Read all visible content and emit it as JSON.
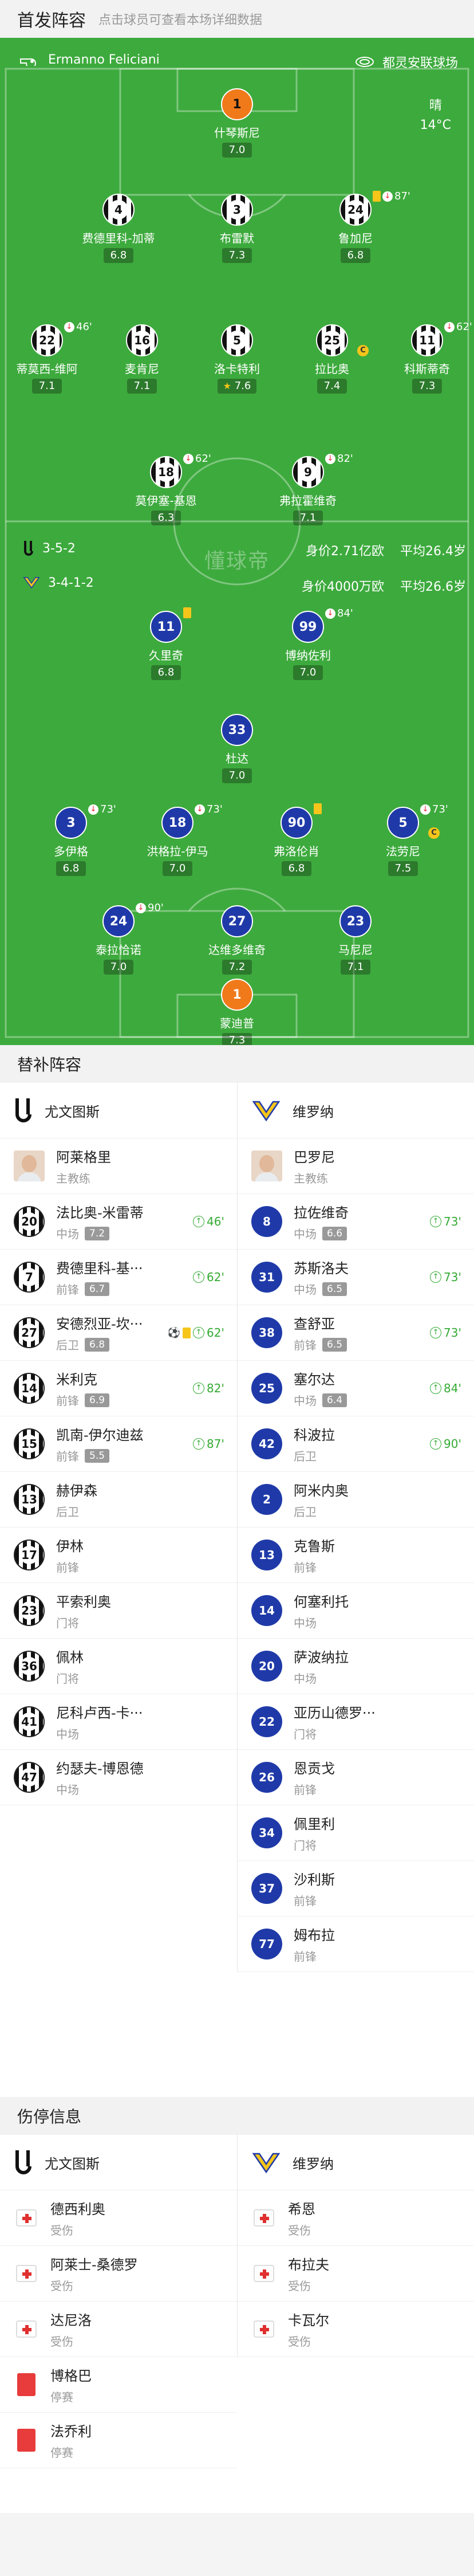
{
  "header": {
    "title": "首发阵容",
    "subtitle": "点击球员可查看本场详细数据"
  },
  "match": {
    "referee": "Ermanno Feliciani",
    "venue": "都灵安联球场",
    "weather": "晴",
    "temperature": "14°C"
  },
  "home": {
    "name": "尤文图斯",
    "formation": "3-5-2",
    "value": "身价2.71亿欧",
    "avg_age": "平均26.4岁",
    "players": [
      {
        "num": "1",
        "name": "什琴斯尼",
        "rating": "7.0"
      },
      {
        "num": "4",
        "name": "费德里科-加蒂",
        "rating": "6.8"
      },
      {
        "num": "3",
        "name": "布雷默",
        "rating": "7.3"
      },
      {
        "num": "24",
        "name": "鲁加尼",
        "rating": "6.8",
        "sub": "87'"
      },
      {
        "num": "22",
        "name": "蒂莫西-维阿",
        "rating": "7.1",
        "sub": "46'"
      },
      {
        "num": "16",
        "name": "麦肯尼",
        "rating": "7.1"
      },
      {
        "num": "5",
        "name": "洛卡特利",
        "rating": "7.6"
      },
      {
        "num": "25",
        "name": "拉比奥",
        "rating": "7.4"
      },
      {
        "num": "11",
        "name": "科斯蒂奇",
        "rating": "7.3",
        "sub": "62'"
      },
      {
        "num": "18",
        "name": "莫伊塞-基恩",
        "rating": "6.3",
        "sub": "62'"
      },
      {
        "num": "9",
        "name": "弗拉霍维奇",
        "rating": "7.1",
        "sub": "82'"
      }
    ]
  },
  "away": {
    "name": "维罗纳",
    "formation": "3-4-1-2",
    "value": "身价4000万欧",
    "avg_age": "平均26.6岁",
    "players": [
      {
        "num": "11",
        "name": "久里奇",
        "rating": "6.8"
      },
      {
        "num": "99",
        "name": "博纳佐利",
        "rating": "7.0",
        "sub": "84'"
      },
      {
        "num": "33",
        "name": "杜达",
        "rating": "7.0"
      },
      {
        "num": "3",
        "name": "多伊格",
        "rating": "6.8",
        "sub": "73'"
      },
      {
        "num": "18",
        "name": "洪格拉-伊马",
        "rating": "7.0",
        "sub": "73'"
      },
      {
        "num": "90",
        "name": "弗洛伦肖",
        "rating": "6.8"
      },
      {
        "num": "5",
        "name": "法劳尼",
        "rating": "7.5",
        "sub": "73'"
      },
      {
        "num": "24",
        "name": "泰拉恰诺",
        "rating": "7.0",
        "sub": "90'"
      },
      {
        "num": "27",
        "name": "达维多维奇",
        "rating": "7.2"
      },
      {
        "num": "23",
        "name": "马尼尼",
        "rating": "7.1"
      },
      {
        "num": "1",
        "name": "蒙迪普",
        "rating": "7.3"
      }
    ]
  },
  "watermark": "懂球帝",
  "subs_section": {
    "title": "替补阵容",
    "home_coach": {
      "name": "阿莱格里",
      "role": "主教练"
    },
    "away_coach": {
      "name": "巴罗尼",
      "role": "主教练"
    },
    "home": [
      {
        "num": "20",
        "name": "法比奥-米雷蒂",
        "pos": "中场",
        "rating": "7.2",
        "in": "46'"
      },
      {
        "num": "7",
        "name": "费德里科-基···",
        "pos": "前锋",
        "rating": "6.7",
        "in": "62'"
      },
      {
        "num": "27",
        "name": "安德烈亚-坎···",
        "pos": "后卫",
        "rating": "6.8",
        "in": "62'"
      },
      {
        "num": "14",
        "name": "米利克",
        "pos": "前锋",
        "rating": "6.9",
        "in": "82'"
      },
      {
        "num": "15",
        "name": "凯南-伊尔迪兹",
        "pos": "前锋",
        "rating": "5.5",
        "in": "87'"
      },
      {
        "num": "13",
        "name": "赫伊森",
        "pos": "后卫"
      },
      {
        "num": "17",
        "name": "伊林",
        "pos": "前锋"
      },
      {
        "num": "23",
        "name": "平索利奥",
        "pos": "门将"
      },
      {
        "num": "36",
        "name": "佩林",
        "pos": "门将"
      },
      {
        "num": "41",
        "name": "尼科卢西-卡···",
        "pos": "中场"
      },
      {
        "num": "47",
        "name": "约瑟夫-博恩德",
        "pos": "中场"
      }
    ],
    "away": [
      {
        "num": "8",
        "name": "拉佐维奇",
        "pos": "中场",
        "rating": "6.6",
        "in": "73'"
      },
      {
        "num": "31",
        "name": "苏斯洛夫",
        "pos": "中场",
        "rating": "6.5",
        "in": "73'"
      },
      {
        "num": "38",
        "name": "查舒亚",
        "pos": "前锋",
        "rating": "6.5",
        "in": "73'"
      },
      {
        "num": "25",
        "name": "塞尔达",
        "pos": "中场",
        "rating": "6.4",
        "in": "84'"
      },
      {
        "num": "42",
        "name": "科波拉",
        "pos": "后卫",
        "in": "90'"
      },
      {
        "num": "2",
        "name": "阿米内奥",
        "pos": "后卫"
      },
      {
        "num": "13",
        "name": "克鲁斯",
        "pos": "前锋"
      },
      {
        "num": "14",
        "name": "何塞利托",
        "pos": "中场"
      },
      {
        "num": "20",
        "name": "萨波纳拉",
        "pos": "中场"
      },
      {
        "num": "22",
        "name": "亚历山德罗···",
        "pos": "门将"
      },
      {
        "num": "26",
        "name": "恩贡戈",
        "pos": "前锋"
      },
      {
        "num": "34",
        "name": "佩里利",
        "pos": "门将"
      },
      {
        "num": "37",
        "name": "沙利斯",
        "pos": "前锋"
      },
      {
        "num": "77",
        "name": "姆布拉",
        "pos": "前锋"
      }
    ]
  },
  "injury_section": {
    "title": "伤停信息",
    "home": [
      {
        "name": "德西利奥",
        "status": "受伤",
        "type": "injury"
      },
      {
        "name": "阿莱士-桑德罗",
        "status": "受伤",
        "type": "injury"
      },
      {
        "name": "达尼洛",
        "status": "受伤",
        "type": "injury"
      },
      {
        "name": "博格巴",
        "status": "停赛",
        "type": "suspension"
      },
      {
        "name": "法乔利",
        "status": "停赛",
        "type": "suspension"
      }
    ],
    "away": [
      {
        "name": "希恩",
        "status": "受伤",
        "type": "injury"
      },
      {
        "name": "布拉夫",
        "status": "受伤",
        "type": "injury"
      },
      {
        "name": "卡瓦尔",
        "status": "受伤",
        "type": "injury"
      }
    ]
  },
  "colors": {
    "pitch": "#3daa3d",
    "verona_blue": "#1f3aa8",
    "gk_orange": "#f07a1a",
    "sub_green": "#33aa33",
    "card_yellow": "#f5c51a",
    "card_red": "#e83b3b"
  }
}
